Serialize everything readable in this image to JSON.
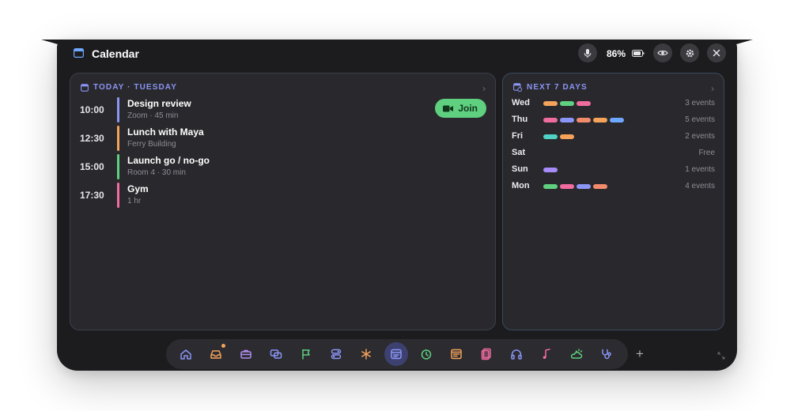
{
  "window": {
    "title": "Calendar",
    "icons": [
      "calendar-icon",
      "microphone-icon",
      "battery-icon",
      "eye-icon",
      "gear-icon",
      "close-icon"
    ]
  },
  "status": {
    "battery_percent": "86%"
  },
  "today": {
    "header": "TODAY · TUESDAY",
    "join_label": "Join",
    "events": [
      {
        "time": "10:00",
        "title": "Design review",
        "subtitle": "Zoom · 45 min",
        "color": "#8b95f5"
      },
      {
        "time": "12:30",
        "title": "Lunch with Maya",
        "subtitle": "Ferry Building",
        "color": "#f5a35a"
      },
      {
        "time": "15:00",
        "title": "Launch go / no-go",
        "subtitle": "Room 4 · 30 min",
        "color": "#5fd07f"
      },
      {
        "time": "17:30",
        "title": "Gym",
        "subtitle": "1 hr",
        "color": "#f06ba0"
      }
    ]
  },
  "week": {
    "header": "NEXT 7 DAYS",
    "days": [
      {
        "day": "Wed",
        "count": "3 events",
        "pills": [
          "#f5a35a",
          "#5fd07f",
          "#f06ba0"
        ]
      },
      {
        "day": "Thu",
        "count": "5 events",
        "pills": [
          "#f06ba0",
          "#8b95f5",
          "#f28b6b",
          "#f5a35a",
          "#6ea8fe"
        ]
      },
      {
        "day": "Fri",
        "count": "2 events",
        "pills": [
          "#4fd1c5",
          "#f5a35a"
        ]
      },
      {
        "day": "Sat",
        "count": "Free",
        "pills": []
      },
      {
        "day": "Sun",
        "count": "1 events",
        "pills": [
          "#a78bfa"
        ]
      },
      {
        "day": "Mon",
        "count": "4 events",
        "pills": [
          "#5fd07f",
          "#f06ba0",
          "#8b95f5",
          "#f28b6b"
        ]
      }
    ]
  },
  "dock": {
    "items": [
      {
        "icon": "home-icon",
        "color": "#8b95f5"
      },
      {
        "icon": "inbox-icon",
        "color": "#f5a35a",
        "badge": true
      },
      {
        "icon": "briefcase-icon",
        "color": "#b18cf0"
      },
      {
        "icon": "chat-icon",
        "color": "#8b95f5"
      },
      {
        "icon": "flag-icon",
        "color": "#5fd07f"
      },
      {
        "icon": "toggles-icon",
        "color": "#8b95f5"
      },
      {
        "icon": "asterisk-icon",
        "color": "#f5a35a"
      },
      {
        "icon": "calendar-icon",
        "color": "#8b95f5",
        "active": true
      },
      {
        "icon": "timer-icon",
        "color": "#5fd07f"
      },
      {
        "icon": "notes-icon",
        "color": "#f5a35a"
      },
      {
        "icon": "cards-icon",
        "color": "#f06ba0"
      },
      {
        "icon": "headphones-icon",
        "color": "#8b95f5"
      },
      {
        "icon": "music-note-icon",
        "color": "#f06ba0"
      },
      {
        "icon": "weather-icon",
        "color": "#5fd07f"
      },
      {
        "icon": "stethoscope-icon",
        "color": "#8b95f5"
      }
    ],
    "add_label": "+"
  }
}
